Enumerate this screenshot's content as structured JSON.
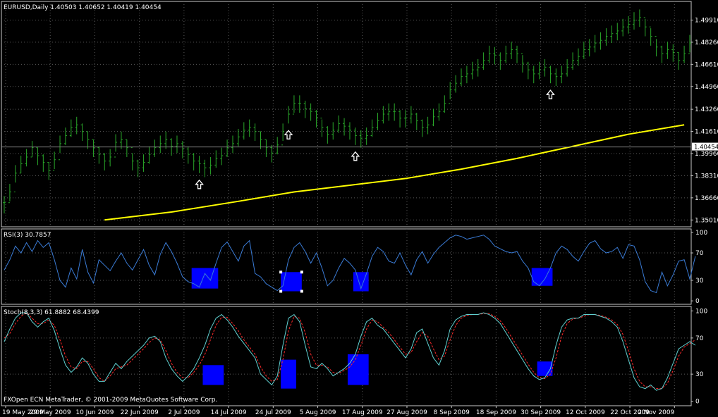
{
  "colors": {
    "background": "#000000",
    "frame": "#c8c8c8",
    "grid": "#5a5a5a",
    "candles": "#2aa82a",
    "moving_average": "#ffff00",
    "rsi_line": "#3a7bd5",
    "stoch_main": "#5fd0d0",
    "stoch_signal": "#ff2a2a",
    "highlight_box": "#0000ff",
    "text": "#ffffff",
    "price_label_bg": "#ffffff",
    "price_label_text": "#000000"
  },
  "icons": {
    "buy_signal": "up-arrow-icon",
    "selection_handle": "square-handle-icon"
  },
  "chart_data": [
    {
      "type": "ohlc",
      "panel": "price",
      "title": "EURUSD,Daily  1.40503 1.40652 1.40419 1.40454",
      "ylim": [
        1.345,
        1.513
      ],
      "y_ticks": [
        "1.49910",
        "1.48260",
        "1.46610",
        "1.44960",
        "1.43260",
        "1.41610",
        "1.39960",
        "1.38310",
        "1.36660",
        "1.35010"
      ],
      "current_price": "1.40454",
      "current_price_value": 1.40454,
      "x_tick_labels": [
        "19 May 2009",
        "29 May 2009",
        "10 Jun 2009",
        "22 Jun 2009",
        "2 Jul 2009",
        "14 Jul 2009",
        "24 Jul 2009",
        "5 Aug 2009",
        "17 Aug 2009",
        "27 Aug 2009",
        "8 Sep 2009",
        "18 Sep 2009",
        "30 Sep 2009",
        "12 Oct 2009",
        "22 Oct 2009",
        "2 Nov 2009"
      ],
      "x_tick_bar_index": [
        0,
        8,
        16,
        24,
        32,
        40,
        48,
        56,
        64,
        72,
        80,
        88,
        96,
        104,
        112,
        120
      ],
      "close": [
        1.363,
        1.371,
        1.385,
        1.392,
        1.397,
        1.404,
        1.398,
        1.393,
        1.387,
        1.395,
        1.407,
        1.413,
        1.419,
        1.421,
        1.416,
        1.41,
        1.404,
        1.399,
        1.394,
        1.397,
        1.408,
        1.41,
        1.404,
        1.394,
        1.389,
        1.393,
        1.399,
        1.404,
        1.407,
        1.41,
        1.405,
        1.407,
        1.403,
        1.399,
        1.394,
        1.392,
        1.389,
        1.391,
        1.396,
        1.398,
        1.404,
        1.407,
        1.412,
        1.417,
        1.419,
        1.416,
        1.41,
        1.404,
        1.4,
        1.406,
        1.416,
        1.429,
        1.437,
        1.437,
        1.433,
        1.431,
        1.426,
        1.419,
        1.414,
        1.417,
        1.422,
        1.42,
        1.417,
        1.413,
        1.411,
        1.413,
        1.419,
        1.424,
        1.429,
        1.431,
        1.431,
        1.426,
        1.426,
        1.429,
        1.424,
        1.419,
        1.421,
        1.427,
        1.431,
        1.437,
        1.447,
        1.452,
        1.457,
        1.459,
        1.462,
        1.464,
        1.469,
        1.474,
        1.473,
        1.469,
        1.474,
        1.477,
        1.474,
        1.467,
        1.462,
        1.459,
        1.462,
        1.464,
        1.459,
        1.457,
        1.459,
        1.464,
        1.469,
        1.472,
        1.477,
        1.479,
        1.482,
        1.484,
        1.487,
        1.489,
        1.491,
        1.494,
        1.496,
        1.499,
        1.501,
        1.494,
        1.487,
        1.479,
        1.474,
        1.477,
        1.475,
        1.469,
        1.474,
        1.482
      ],
      "high": [
        1.368,
        1.377,
        1.391,
        1.398,
        1.403,
        1.409,
        1.404,
        1.399,
        1.393,
        1.401,
        1.413,
        1.419,
        1.425,
        1.427,
        1.422,
        1.416,
        1.41,
        1.405,
        1.4,
        1.403,
        1.414,
        1.416,
        1.41,
        1.4,
        1.395,
        1.399,
        1.405,
        1.41,
        1.413,
        1.416,
        1.411,
        1.413,
        1.409,
        1.405,
        1.4,
        1.398,
        1.395,
        1.397,
        1.402,
        1.404,
        1.41,
        1.413,
        1.418,
        1.423,
        1.425,
        1.422,
        1.416,
        1.41,
        1.406,
        1.412,
        1.422,
        1.435,
        1.443,
        1.443,
        1.439,
        1.437,
        1.432,
        1.425,
        1.42,
        1.423,
        1.428,
        1.426,
        1.423,
        1.419,
        1.417,
        1.419,
        1.425,
        1.43,
        1.435,
        1.437,
        1.437,
        1.432,
        1.432,
        1.435,
        1.43,
        1.425,
        1.427,
        1.433,
        1.437,
        1.443,
        1.453,
        1.458,
        1.463,
        1.465,
        1.468,
        1.47,
        1.475,
        1.48,
        1.479,
        1.475,
        1.48,
        1.483,
        1.48,
        1.473,
        1.468,
        1.465,
        1.468,
        1.47,
        1.465,
        1.463,
        1.465,
        1.47,
        1.475,
        1.478,
        1.483,
        1.485,
        1.488,
        1.49,
        1.493,
        1.495,
        1.497,
        1.5,
        1.502,
        1.505,
        1.507,
        1.5,
        1.493,
        1.485,
        1.48,
        1.483,
        1.481,
        1.475,
        1.48,
        1.488
      ],
      "low": [
        1.355,
        1.364,
        1.378,
        1.385,
        1.39,
        1.397,
        1.391,
        1.386,
        1.38,
        1.388,
        1.4,
        1.406,
        1.412,
        1.414,
        1.409,
        1.403,
        1.397,
        1.392,
        1.387,
        1.39,
        1.401,
        1.403,
        1.397,
        1.387,
        1.382,
        1.386,
        1.392,
        1.397,
        1.4,
        1.403,
        1.398,
        1.4,
        1.396,
        1.392,
        1.387,
        1.385,
        1.382,
        1.384,
        1.389,
        1.391,
        1.397,
        1.4,
        1.405,
        1.41,
        1.412,
        1.409,
        1.403,
        1.397,
        1.393,
        1.399,
        1.409,
        1.422,
        1.43,
        1.43,
        1.426,
        1.424,
        1.419,
        1.412,
        1.407,
        1.41,
        1.415,
        1.413,
        1.41,
        1.406,
        1.404,
        1.406,
        1.412,
        1.417,
        1.422,
        1.424,
        1.424,
        1.419,
        1.419,
        1.422,
        1.417,
        1.412,
        1.414,
        1.42,
        1.424,
        1.43,
        1.44,
        1.445,
        1.45,
        1.452,
        1.455,
        1.457,
        1.462,
        1.467,
        1.466,
        1.462,
        1.467,
        1.47,
        1.467,
        1.46,
        1.455,
        1.452,
        1.455,
        1.457,
        1.452,
        1.45,
        1.452,
        1.457,
        1.462,
        1.465,
        1.47,
        1.472,
        1.475,
        1.477,
        1.48,
        1.482,
        1.484,
        1.487,
        1.489,
        1.492,
        1.494,
        1.487,
        1.48,
        1.472,
        1.467,
        1.47,
        1.468,
        1.462,
        1.467,
        1.475
      ],
      "moving_average": [
        {
          "bar": 18,
          "y": 1.3501
        },
        {
          "bar": 30,
          "y": 1.356
        },
        {
          "bar": 42,
          "y": 1.364
        },
        {
          "bar": 52,
          "y": 1.371
        },
        {
          "bar": 62,
          "y": 1.376
        },
        {
          "bar": 72,
          "y": 1.381
        },
        {
          "bar": 82,
          "y": 1.388
        },
        {
          "bar": 92,
          "y": 1.396
        },
        {
          "bar": 102,
          "y": 1.405
        },
        {
          "bar": 112,
          "y": 1.414
        },
        {
          "bar": 122,
          "y": 1.421
        }
      ],
      "buy_signal_bars": [
        35,
        51,
        63,
        98
      ]
    },
    {
      "type": "line",
      "panel": "rsi",
      "title": "RSI(3) 30.7857",
      "ylim": [
        -5,
        105
      ],
      "y_ticks": [
        "100",
        "70",
        "30",
        "0"
      ],
      "y_tick_values": [
        100,
        70,
        30,
        0
      ],
      "values": [
        45,
        60,
        80,
        70,
        85,
        72,
        88,
        78,
        85,
        60,
        30,
        20,
        48,
        32,
        75,
        42,
        26,
        60,
        52,
        44,
        58,
        70,
        55,
        45,
        60,
        75,
        52,
        38,
        68,
        85,
        72,
        55,
        35,
        28,
        25,
        20,
        40,
        30,
        55,
        78,
        86,
        72,
        58,
        80,
        88,
        40,
        35,
        25,
        20,
        15,
        22,
        60,
        78,
        85,
        72,
        55,
        70,
        48,
        22,
        30,
        48,
        62,
        55,
        45,
        18,
        40,
        65,
        78,
        72,
        58,
        55,
        70,
        52,
        38,
        60,
        72,
        55,
        68,
        78,
        85,
        92,
        96,
        94,
        90,
        92,
        94,
        96,
        90,
        80,
        76,
        72,
        70,
        72,
        58,
        48,
        28,
        22,
        32,
        48,
        70,
        80,
        75,
        65,
        58,
        72,
        84,
        88,
        76,
        70,
        72,
        78,
        62,
        82,
        80,
        60,
        28,
        15,
        12,
        42,
        22,
        38,
        58,
        60,
        32,
        65
      ],
      "highlight_boxes": [
        {
          "bar_from": 34,
          "bar_to": 38,
          "y_from": 18,
          "y_to": 48
        },
        {
          "bar_from": 50,
          "bar_to": 53,
          "y_from": 14,
          "y_to": 42
        },
        {
          "bar_from": 63,
          "bar_to": 65,
          "y_from": 14,
          "y_to": 42
        },
        {
          "bar_from": 95,
          "bar_to": 98,
          "y_from": 22,
          "y_to": 48
        }
      ]
    },
    {
      "type": "line",
      "panel": "stochastic",
      "title": "Stoch(8,3,3) 61.8882 68.4399",
      "ylim": [
        -5,
        105
      ],
      "y_ticks": [
        "100",
        "70",
        "30",
        "0"
      ],
      "y_tick_values": [
        100,
        70,
        30,
        0
      ],
      "series": [
        {
          "values": [
            66,
            80,
            92,
            98,
            98,
            88,
            82,
            88,
            92,
            78,
            58,
            40,
            32,
            38,
            48,
            42,
            30,
            22,
            22,
            32,
            42,
            36,
            44,
            50,
            56,
            62,
            70,
            72,
            66,
            48,
            36,
            28,
            22,
            28,
            36,
            48,
            62,
            80,
            92,
            96,
            90,
            82,
            72,
            64,
            56,
            48,
            30,
            24,
            18,
            28,
            62,
            92,
            96,
            88,
            62,
            38,
            36,
            42,
            36,
            28,
            32,
            36,
            42,
            52,
            72,
            88,
            92,
            84,
            80,
            72,
            64,
            56,
            48,
            58,
            76,
            80,
            64,
            48,
            40,
            56,
            80,
            90,
            94,
            96,
            96,
            96,
            98,
            96,
            92,
            86,
            76,
            66,
            56,
            46,
            36,
            28,
            24,
            26,
            36,
            62,
            82,
            90,
            92,
            92,
            96,
            96,
            96,
            94,
            92,
            88,
            82,
            66,
            46,
            26,
            16,
            14,
            18,
            12,
            14,
            26,
            42,
            58,
            62,
            66,
            62
          ]
        },
        {
          "values": [
            70,
            75,
            86,
            94,
            98,
            92,
            86,
            86,
            90,
            84,
            68,
            50,
            38,
            36,
            44,
            44,
            36,
            26,
            22,
            28,
            36,
            38,
            40,
            46,
            52,
            58,
            65,
            70,
            68,
            56,
            42,
            32,
            26,
            26,
            32,
            40,
            52,
            68,
            84,
            93,
            93,
            86,
            78,
            68,
            60,
            52,
            38,
            28,
            22,
            24,
            46,
            78,
            94,
            92,
            76,
            52,
            40,
            40,
            38,
            32,
            31,
            34,
            38,
            46,
            62,
            80,
            90,
            88,
            82,
            76,
            68,
            60,
            52,
            54,
            66,
            76,
            72,
            58,
            46,
            50,
            68,
            84,
            92,
            95,
            96,
            96,
            97,
            97,
            94,
            89,
            81,
            71,
            61,
            51,
            41,
            32,
            26,
            25,
            30,
            48,
            72,
            86,
            91,
            92,
            94,
            96,
            96,
            95,
            93,
            90,
            85,
            74,
            56,
            36,
            22,
            16,
            16,
            14,
            14,
            20,
            34,
            50,
            60,
            64,
            68
          ]
        }
      ],
      "highlight_boxes": [
        {
          "bar_from": 36,
          "bar_to": 39,
          "y_from": 18,
          "y_to": 40
        },
        {
          "bar_from": 50,
          "bar_to": 52,
          "y_from": 14,
          "y_to": 46
        },
        {
          "bar_from": 62,
          "bar_to": 65,
          "y_from": 18,
          "y_to": 52
        },
        {
          "bar_from": 96,
          "bar_to": 98,
          "y_from": 28,
          "y_to": 44
        }
      ],
      "footer": "FXOpen ECN MetaTrader, © 2001-2009 MetaQuotes Software Corp."
    }
  ]
}
